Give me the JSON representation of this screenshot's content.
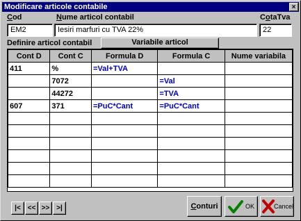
{
  "window": {
    "title": "Modificare articole contabile",
    "close_glyph": "×"
  },
  "form": {
    "cod_label_u": "C",
    "cod_label_rest": "od",
    "nume_label_u": "N",
    "nume_label_rest": "ume articol contabil",
    "cota_label_pre": "C",
    "cota_label_u": "o",
    "cota_label_rest": "taTva",
    "cod_value": "EM2",
    "nume_value": "Iesiri marfuri cu TVA 22%",
    "cota_value": "22",
    "definire_label": "Definire articol contabil",
    "variabile_button": "Variabile articol"
  },
  "table": {
    "headers": [
      "Cont D",
      "Cont C",
      "Formula D",
      "Formula C",
      "Nume variabila"
    ],
    "rows": [
      [
        "411",
        "%",
        "=Val+TVA",
        "",
        ""
      ],
      [
        "",
        "7072",
        "",
        "=Val",
        ""
      ],
      [
        "",
        "44272",
        "",
        "=TVA",
        ""
      ],
      [
        "607",
        "371",
        "=PuC*Cant",
        "=PuC*Cant",
        ""
      ],
      [
        "",
        "",
        "",
        "",
        ""
      ],
      [
        "",
        "",
        "",
        "",
        ""
      ],
      [
        "",
        "",
        "",
        "",
        ""
      ],
      [
        "",
        "",
        "",
        "",
        ""
      ],
      [
        "",
        "",
        "",
        "",
        ""
      ],
      [
        "",
        "",
        "",
        "",
        ""
      ]
    ]
  },
  "nav": {
    "first": "|<",
    "prev": "<<",
    "next": ">>",
    "last": ">|"
  },
  "actions": {
    "conturi_u": "C",
    "conturi_rest": "onturi",
    "ok_label": "OK",
    "cancel_label": "Cancel"
  },
  "colors": {
    "title_bg": "#000080",
    "formula_text": "#0000c0",
    "ok_check": "#008000",
    "cancel_x": "#c00000"
  }
}
